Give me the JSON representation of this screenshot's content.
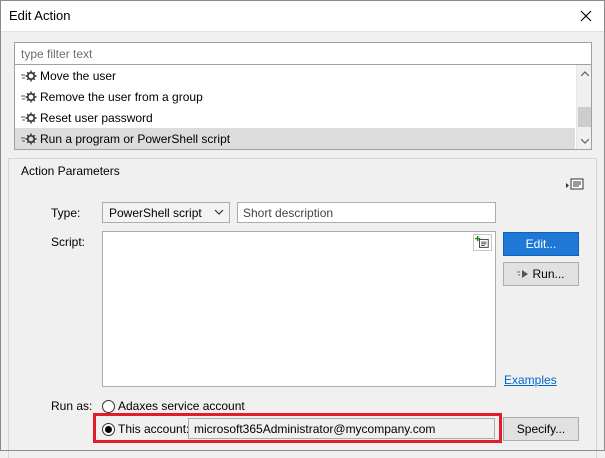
{
  "window": {
    "title": "Edit Action"
  },
  "filter": {
    "placeholder": "type filter text"
  },
  "actions_list": {
    "items": [
      {
        "label": "Move the user"
      },
      {
        "label": "Remove the user from a group"
      },
      {
        "label": "Reset user password"
      },
      {
        "label": "Run a program or PowerShell script"
      }
    ],
    "selected_index": 3
  },
  "parameters": {
    "title": "Action Parameters",
    "type_label": "Type:",
    "type_value": "PowerShell script",
    "description_placeholder": "Short description",
    "script_label": "Script:",
    "script_value": "",
    "edit_button": "Edit...",
    "run_button": "Run...",
    "examples_link": "Examples",
    "run_as_label": "Run as:",
    "run_as_options": [
      {
        "label": "Adaxes service account",
        "checked": false
      },
      {
        "label": "This account:",
        "checked": true
      }
    ],
    "account_value": "microsoft365Administrator@mycompany.com",
    "specify_button": "Specify..."
  },
  "colors": {
    "accent": "#1e78d7",
    "highlight": "#e01e2a",
    "selection": "#dcdcdc"
  },
  "icons": [
    "close-icon",
    "gear-icon",
    "scroll-up-icon",
    "scroll-down-icon",
    "chevron-down-icon",
    "insert-icon",
    "run-icon",
    "menu-icon"
  ]
}
